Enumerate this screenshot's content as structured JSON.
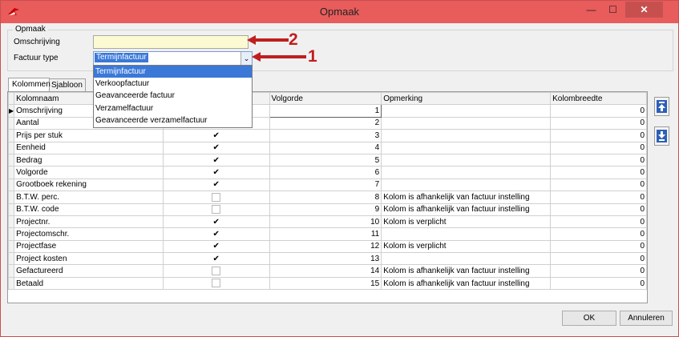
{
  "window": {
    "title": "Opmaak",
    "minimize_glyph": "—",
    "maximize_glyph": "☐",
    "close_glyph": "✕",
    "app_icon": "red-logo-icon"
  },
  "form": {
    "group_label": "Opmaak",
    "omschrijving_label": "Omschrijving",
    "omschrijving_value": "",
    "factuur_type_label": "Factuur type",
    "factuur_type_value": "Termijnfactuur",
    "factuur_type_options": [
      "Termijnfactuur",
      "Verkoopfactuur",
      "Geavanceerde factuur",
      "Verzamelfactuur",
      "Geavanceerde verzamelfactuur"
    ]
  },
  "annotations": {
    "arrow_2": "2",
    "arrow_1": "1",
    "color": "#c01e1e"
  },
  "tabs": [
    "Kolommen",
    "Sjabloon"
  ],
  "grid": {
    "columns": [
      "Kolomnaam",
      "",
      "Volgorde",
      "Opmerking",
      "Kolombreedte"
    ],
    "rows": [
      {
        "name": "Omschrijving",
        "checked": true,
        "volgorde": "1",
        "opmerking": "",
        "breedte": "0"
      },
      {
        "name": "Aantal",
        "checked": true,
        "volgorde": "2",
        "opmerking": "",
        "breedte": "0"
      },
      {
        "name": "Prijs per stuk",
        "checked": true,
        "volgorde": "3",
        "opmerking": "",
        "breedte": "0"
      },
      {
        "name": "Eenheid",
        "checked": true,
        "volgorde": "4",
        "opmerking": "",
        "breedte": "0"
      },
      {
        "name": "Bedrag",
        "checked": true,
        "volgorde": "5",
        "opmerking": "",
        "breedte": "0"
      },
      {
        "name": "Volgorde",
        "checked": true,
        "volgorde": "6",
        "opmerking": "",
        "breedte": "0"
      },
      {
        "name": "Grootboek rekening",
        "checked": true,
        "volgorde": "7",
        "opmerking": "",
        "breedte": "0"
      },
      {
        "name": "B.T.W. perc.",
        "checked": false,
        "volgorde": "8",
        "opmerking": "Kolom is afhankelijk van factuur instelling",
        "breedte": "0"
      },
      {
        "name": "B.T.W. code",
        "checked": false,
        "volgorde": "9",
        "opmerking": "Kolom is afhankelijk van factuur instelling",
        "breedte": "0"
      },
      {
        "name": "Projectnr.",
        "checked": true,
        "volgorde": "10",
        "opmerking": "Kolom is verplicht",
        "breedte": "0"
      },
      {
        "name": "Projectomschr.",
        "checked": true,
        "volgorde": "11",
        "opmerking": "",
        "breedte": "0"
      },
      {
        "name": "Projectfase",
        "checked": true,
        "volgorde": "12",
        "opmerking": "Kolom is verplicht",
        "breedte": "0"
      },
      {
        "name": "Project kosten",
        "checked": true,
        "volgorde": "13",
        "opmerking": "",
        "breedte": "0"
      },
      {
        "name": "Gefactureerd",
        "checked": false,
        "volgorde": "14",
        "opmerking": "Kolom is afhankelijk van factuur instelling",
        "breedte": "0"
      },
      {
        "name": "Betaald",
        "checked": false,
        "volgorde": "15",
        "opmerking": "Kolom is afhankelijk van factuur instelling",
        "breedte": "0"
      }
    ]
  },
  "side_buttons": {
    "up_icon": "move-up-icon",
    "down_icon": "move-down-icon"
  },
  "buttons": {
    "ok": "OK",
    "cancel": "Annuleren"
  },
  "glyphs": {
    "check": "✔",
    "chevron": "⌄",
    "row_pointer": "▶"
  },
  "colors": {
    "titlebar": "#e85c5c",
    "selection": "#3b78d8",
    "input_bg": "#fcfad2"
  }
}
